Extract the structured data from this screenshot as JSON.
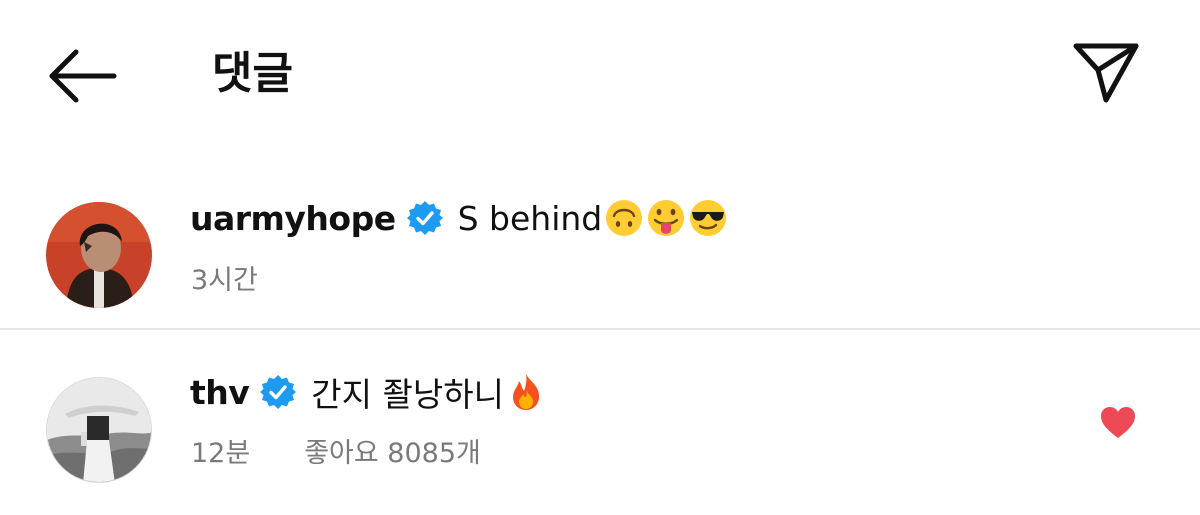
{
  "header": {
    "title": "댓글",
    "back_icon": "arrow-left-icon",
    "send_icon": "paper-plane-icon"
  },
  "comments": [
    {
      "username": "uarmyhope",
      "verified": true,
      "text": "S behind",
      "emojis": [
        "upside-down-face",
        "tongue-out-face",
        "sunglasses-face"
      ],
      "time": "3시간"
    },
    {
      "username": "thv",
      "verified": true,
      "text": "간지 좔낭하니",
      "emojis": [
        "fire"
      ],
      "time": "12분",
      "likes": "좋아요 8085개",
      "liked": true
    }
  ],
  "colors": {
    "verified_blue": "#1d9bf0",
    "heart_red": "#ed4956",
    "meta_gray": "#7a7a7a",
    "divider": "#e6e6e6"
  }
}
